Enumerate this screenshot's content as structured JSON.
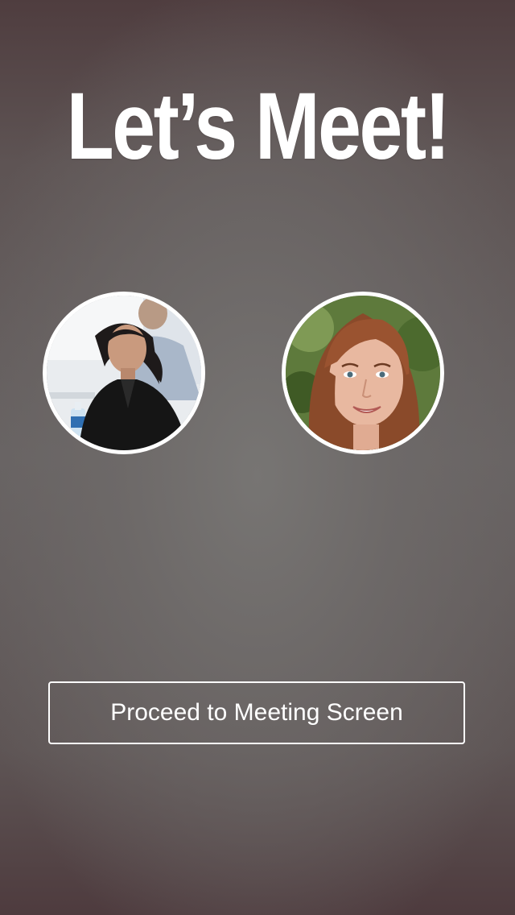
{
  "header": {
    "title": "Let’s Meet!"
  },
  "participants": [
    {
      "icon": "avatar-woman-black-jacket-photo"
    },
    {
      "icon": "avatar-woman-auburn-hair-photo"
    }
  ],
  "actions": {
    "proceed_label": "Proceed to Meeting Screen"
  },
  "colors": {
    "text": "#ffffff",
    "background_center": "#6f6d6c",
    "background_edge": "#4f3d3f"
  }
}
